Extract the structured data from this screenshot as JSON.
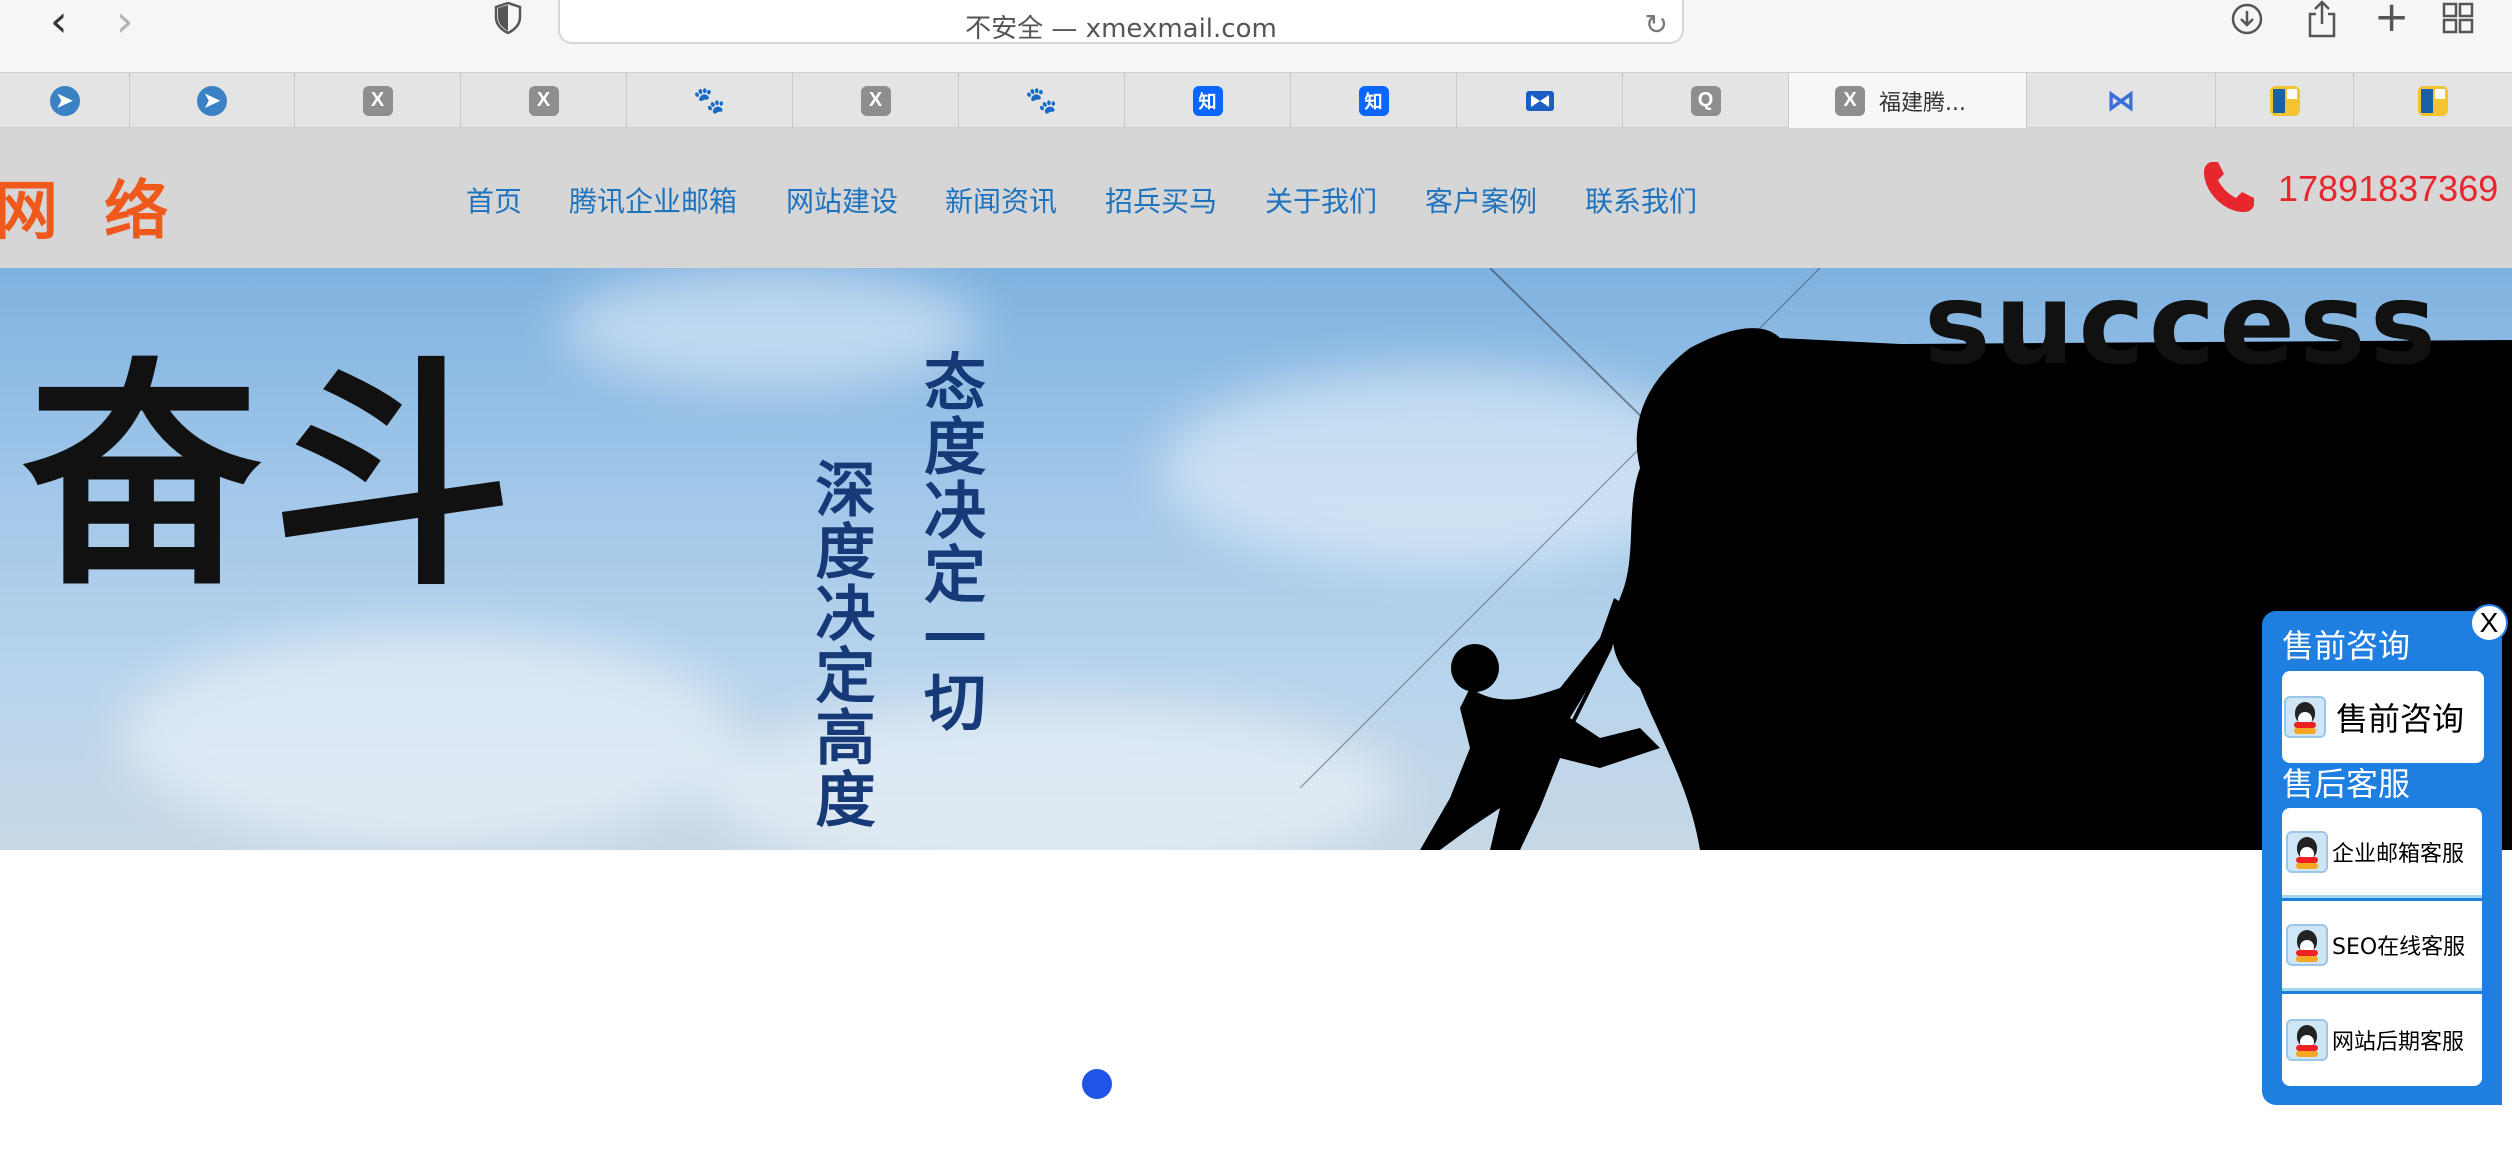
{
  "browser": {
    "address": "不安全 — xmexmail.com",
    "tabs": [
      {
        "icon": "blue-circle-icon"
      },
      {
        "icon": "blue-circle-icon"
      },
      {
        "icon": "x-icon",
        "glyph": "X"
      },
      {
        "icon": "x-icon",
        "glyph": "X"
      },
      {
        "icon": "baidu-paw-icon",
        "glyph": "🐾"
      },
      {
        "icon": "x-icon",
        "glyph": "X"
      },
      {
        "icon": "baidu-paw-icon",
        "glyph": "🐾"
      },
      {
        "icon": "zhihu-icon",
        "glyph": "知"
      },
      {
        "icon": "zhihu-icon",
        "glyph": "知"
      },
      {
        "icon": "ms-icon"
      },
      {
        "icon": "q-icon",
        "glyph": "Q"
      },
      {
        "icon": "x-icon",
        "glyph": "X",
        "title": "福建腾...",
        "active": true
      },
      {
        "icon": "m-icon",
        "glyph": "⋈"
      },
      {
        "icon": "square-icon"
      },
      {
        "icon": "square-icon"
      }
    ]
  },
  "header": {
    "logo": "网 络",
    "nav": [
      "首页",
      "腾讯企业邮箱",
      "网站建设",
      "新闻资讯",
      "招兵买马",
      "关于我们",
      "客户案例",
      "联系我们"
    ],
    "phone": "17891837369"
  },
  "banner": {
    "big_text": "奋斗",
    "vertical_1": "态度决定一切",
    "vertical_2": "深度决定高度",
    "success": "success"
  },
  "service": {
    "close": "X",
    "presale_heading": "售前咨询",
    "presale_item": "售前咨询",
    "aftersale_heading": "售后客服",
    "items": [
      "企业邮箱客服",
      "SEO在线客服",
      "网站后期客服"
    ]
  },
  "colors": {
    "nav_link": "#1e73be",
    "phone": "#e8262d",
    "logo": "#ef5a1c",
    "panel": "#1e7fe0",
    "slider_dot": "#1e55e6"
  }
}
